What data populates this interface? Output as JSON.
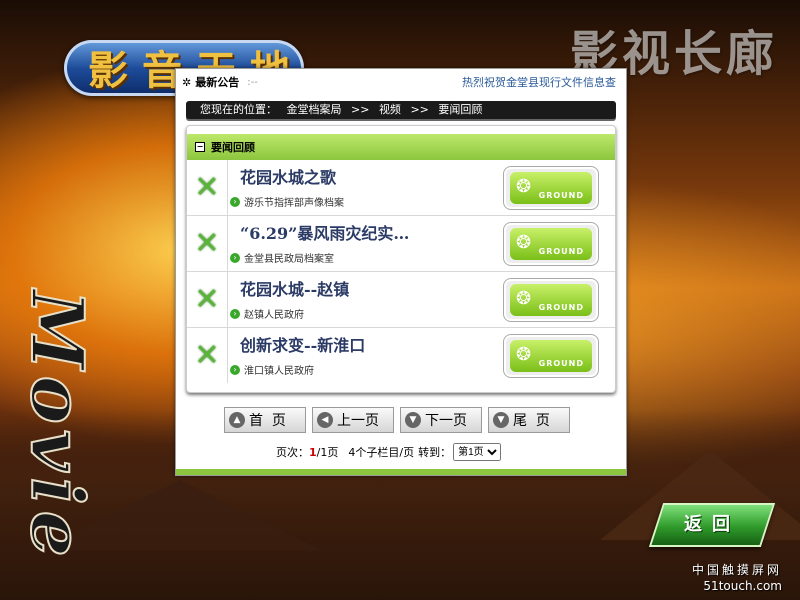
{
  "header": {
    "logo_text": "影音天地",
    "big_title": "影视长廊",
    "side_text": "Movie"
  },
  "notice": {
    "label": "最新公告",
    "spinner": ":--",
    "message": "热烈祝贺金堂县现行文件信息查"
  },
  "breadcrumb": {
    "prefix": "您现在的位置：",
    "parts": [
      "金堂档案局",
      ">>",
      "视频",
      ">>",
      "要闻回顾"
    ]
  },
  "section": {
    "title": "要闻回顾"
  },
  "items": [
    {
      "title": "花园水城之歌",
      "subtitle": "游乐节指挥部声像档案",
      "button": "GROUND"
    },
    {
      "title": "“6.29”暴风雨灾纪实…",
      "subtitle": "金堂县民政局档案室",
      "button": "GROUND"
    },
    {
      "title": "花园水城--赵镇",
      "subtitle": "赵镇人民政府",
      "button": "GROUND"
    },
    {
      "title": "创新求变--新淮口",
      "subtitle": "淮口镇人民政府",
      "button": "GROUND"
    }
  ],
  "pager": {
    "first": "首  页",
    "prev": "上一页",
    "next": "下一页",
    "last": "尾  页"
  },
  "page_info": {
    "label": "页次：",
    "current": "1",
    "total": "/1页",
    "per_page": "4个子栏目/页",
    "goto": "转到：",
    "selected": "第1页"
  },
  "back_button": "返回",
  "watermark": {
    "line1": "中国触摸屏网",
    "line2": "51touch.com"
  },
  "colors": {
    "accent_green": "#8cc63e",
    "title_blue": "#2b3b66"
  }
}
